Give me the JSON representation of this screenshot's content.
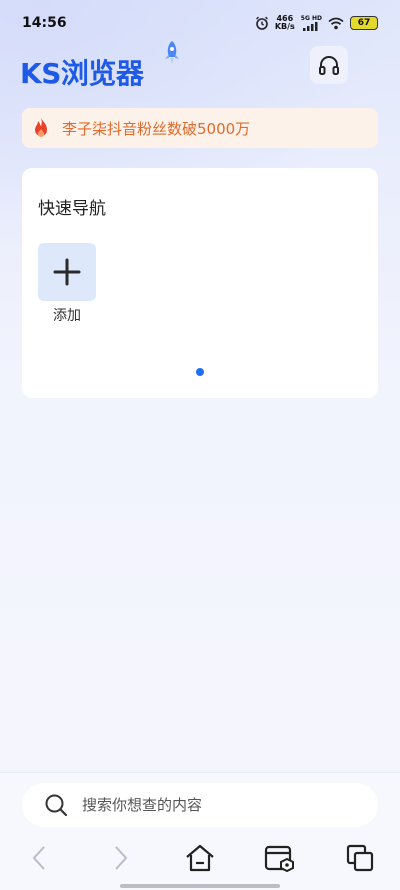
{
  "status": {
    "time": "14:56",
    "speed_value": "466",
    "speed_unit": "KB/s",
    "network": "5G HD",
    "battery": "67"
  },
  "header": {
    "logo": "KS浏览器"
  },
  "hot": {
    "text": "李子柒抖音粉丝数破5000万"
  },
  "quick_nav": {
    "title": "快速导航",
    "add_label": "添加"
  },
  "search": {
    "placeholder": "搜索你想查的内容"
  },
  "colors": {
    "brand": "#1f5ae6",
    "hot_text": "#e06b2c",
    "hot_bg": "#fdf2ea",
    "accent_dot": "#1f6ff0"
  },
  "icons": [
    "alarm-icon",
    "signal-icon",
    "wifi-icon",
    "battery-icon",
    "rocket-icon",
    "headphones-icon",
    "fire-icon",
    "plus-icon",
    "search-icon",
    "back-icon",
    "forward-icon",
    "home-icon",
    "cards-icon",
    "tabs-icon"
  ]
}
